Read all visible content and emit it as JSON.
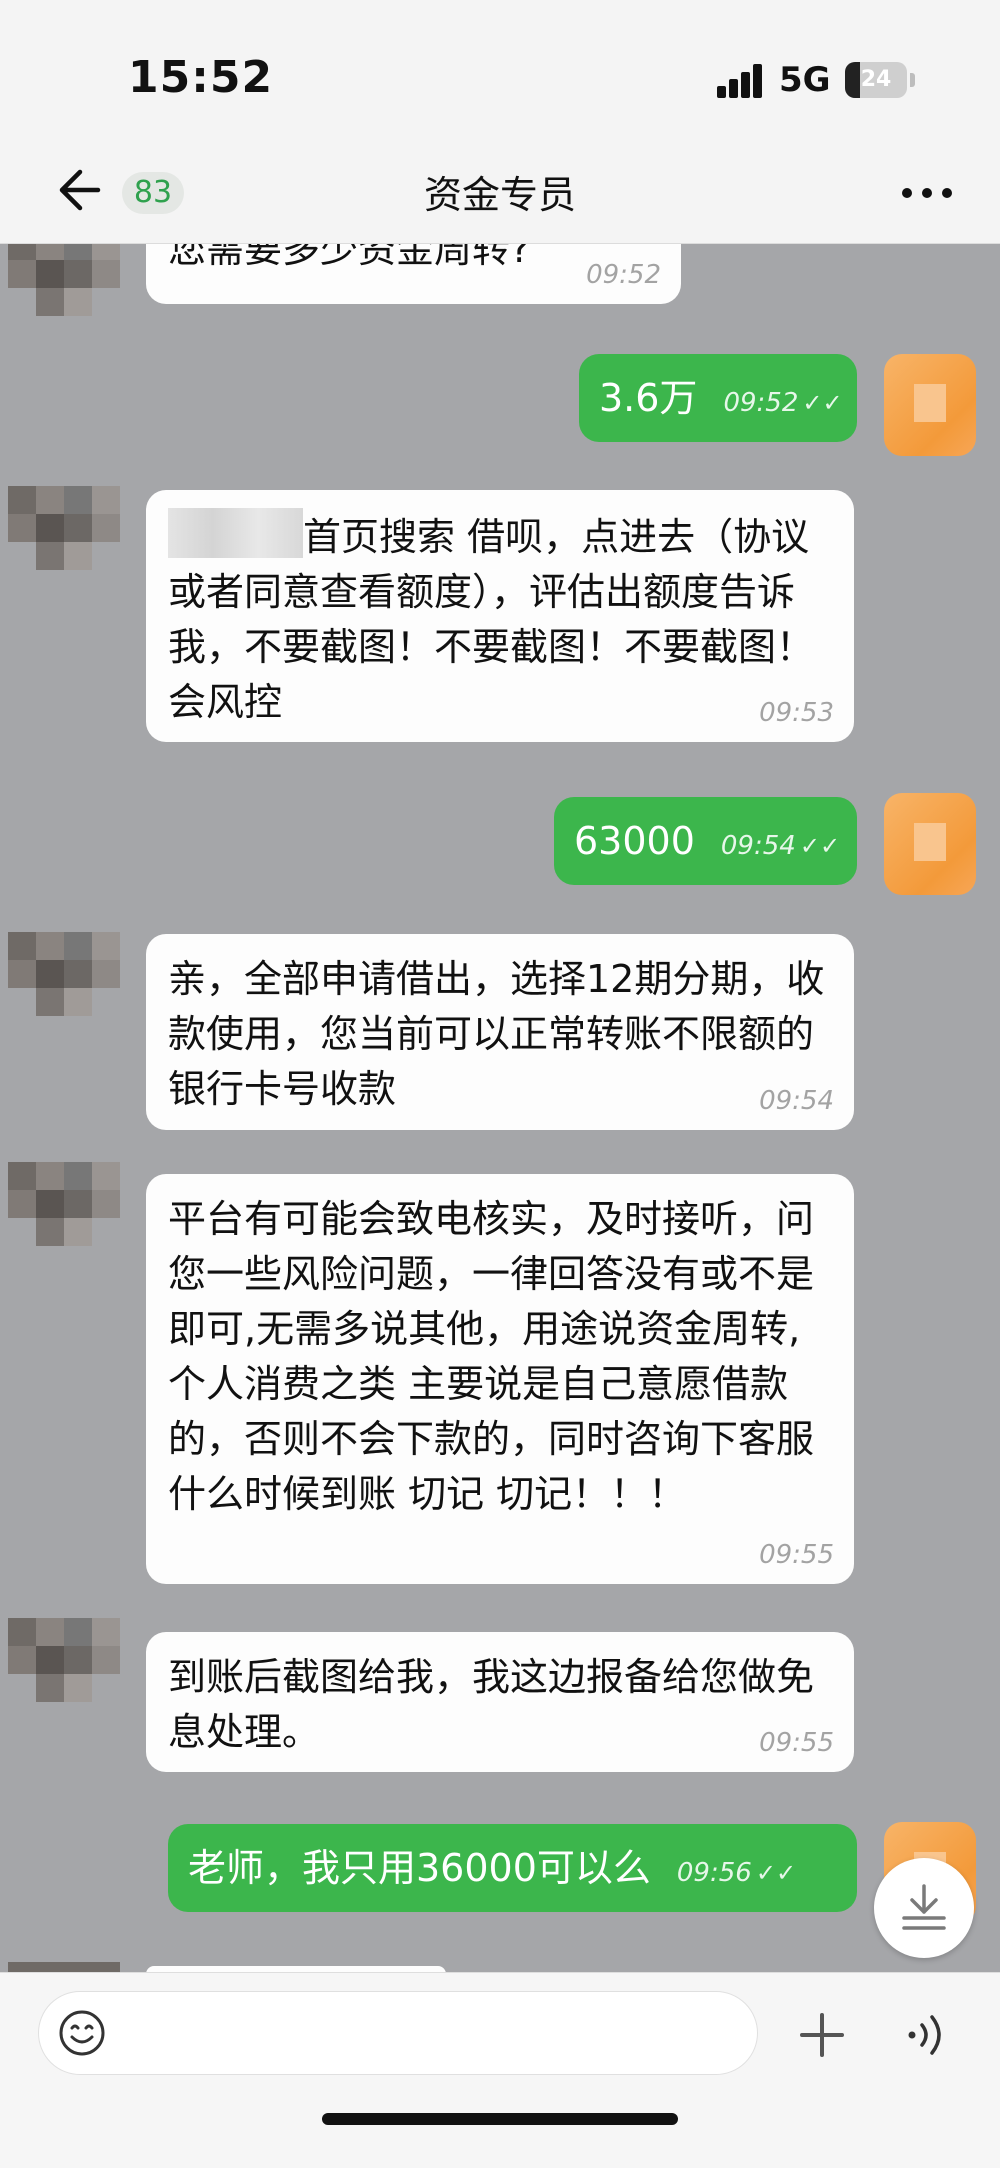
{
  "status_bar": {
    "time": "15:52",
    "network": "5G",
    "battery": "24",
    "battery_level_percent": 24
  },
  "nav": {
    "unread_count": "83",
    "title": "资金专员"
  },
  "messages": [
    {
      "from": "contact",
      "text": "您需要多少资金周转?",
      "time": "09:52"
    },
    {
      "from": "self",
      "text": "3.6万",
      "time": "09:52"
    },
    {
      "from": "contact",
      "text": "首页搜索 借呗，点进去（协议或者同意查看额度），评估出额度告诉我，不要截图！不要截图！不要截图！会风控",
      "time": "09:53"
    },
    {
      "from": "self",
      "text": "63000",
      "time": "09:54"
    },
    {
      "from": "contact",
      "text": "亲，全部申请借出，选择12期分期，收款使用，您当前可以正常转账不限额的银行卡号收款",
      "time": "09:54"
    },
    {
      "from": "contact",
      "text": "平台有可能会致电核实，及时接听，问您一些风险问题，一律回答没有或不是即可,无需多说其他，用途说资金周转,个人消费之类 主要说是自己意愿借款的，否则不会下款的，同时咨询下客服什么时候到账  切记 切记！！！",
      "time": "09:55"
    },
    {
      "from": "contact",
      "text": "到账后截图给我，我这边报备给您做免息处理。",
      "time": "09:55"
    },
    {
      "from": "self",
      "text": "老师，我只用36000可以么",
      "time": "09:56"
    }
  ],
  "colors": {
    "chat_background": "#a5a6a9",
    "outgoing_bubble": "#3cb64c",
    "incoming_bubble": "#fdfdfd",
    "unread_badge_text": "#2fa14e"
  },
  "icons": {
    "back": "arrow-left",
    "more": "three-dots",
    "scroll_down": "download-arrow",
    "emoji": "smiley-face",
    "plus": "plus",
    "voice": "sound-waves"
  }
}
